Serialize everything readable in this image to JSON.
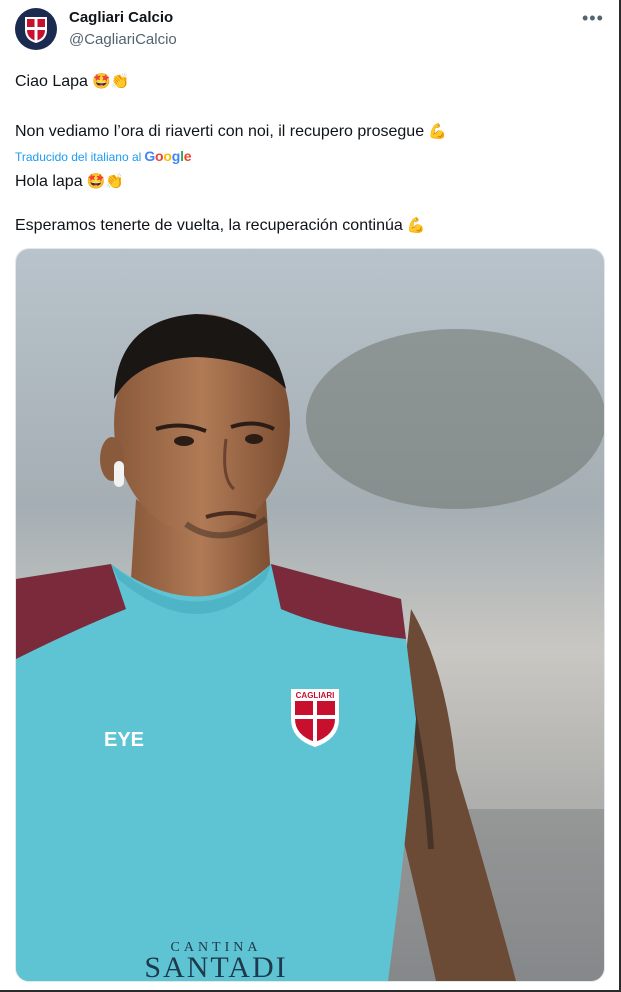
{
  "account": {
    "name": "Cagliari Calcio",
    "handle": "@CagliariCalcio",
    "more_label": "•••"
  },
  "tweet": {
    "line1": "Ciao Lapa",
    "line1_emoji": "🤩👏",
    "line2": "Non vediamo l’ora di riaverti con noi, il recupero prosegue",
    "line2_emoji": "💪",
    "translation_label": "Traducido del italiano al",
    "translation_brand": "Google",
    "line3": "Hola lapa",
    "line3_emoji": "🤩👏",
    "line4": "Esperamos tenerte de vuelta, la recuperación continúa",
    "line4_emoji": "💪"
  },
  "photo": {
    "shirt_brand": "EYE",
    "crest_text": "CAGLIARI",
    "sponsor_top": "CANTINA",
    "sponsor_bottom": "SANTADI"
  },
  "colors": {
    "brand_blue": "#1d9bf0",
    "shirt_teal": "#5ec4d4",
    "shirt_maroon": "#7a2a3a"
  }
}
